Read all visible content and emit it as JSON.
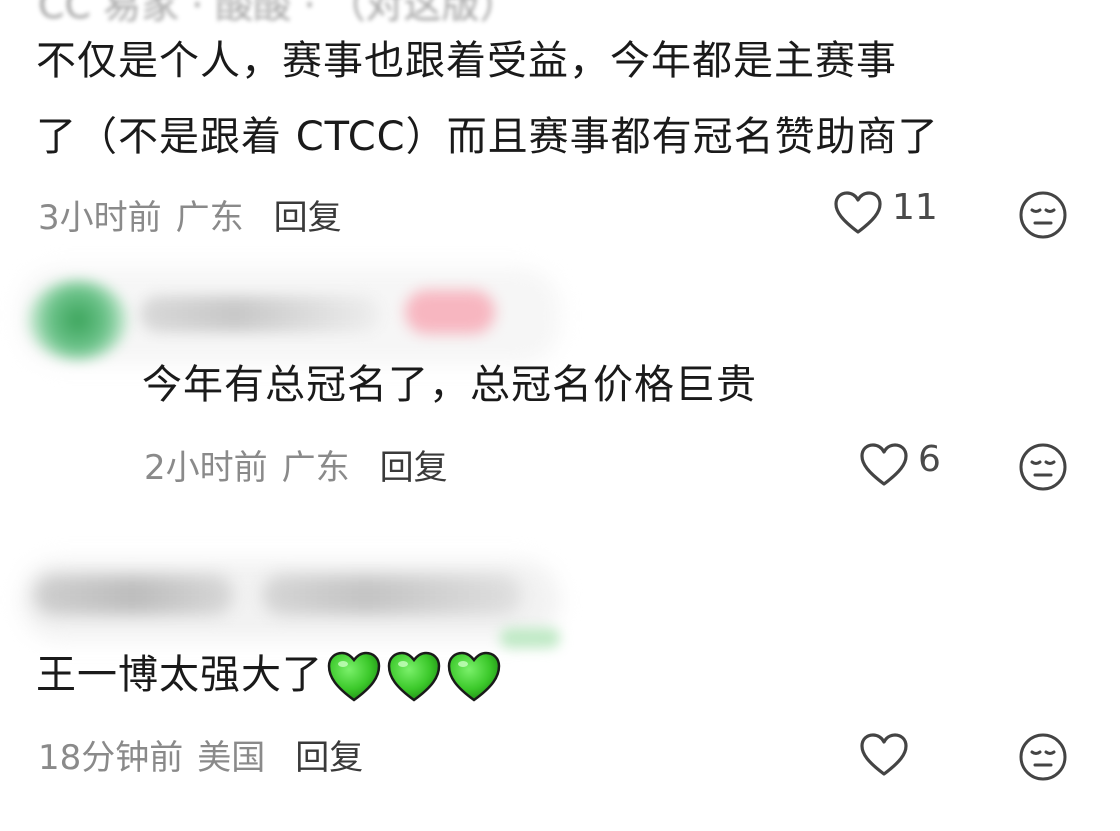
{
  "top_username_cutoff": "CC 易家 · 酸酸 · （对这版）",
  "comment1": {
    "line1": "不仅是个人，赛事也跟着受益，今年都是主赛事",
    "line2": "了（不是跟着 CTCC）而且赛事都有冠名赞助商了",
    "time": "3小时前",
    "location": "广东",
    "reply_label": "回复",
    "like_count": "11"
  },
  "reply1": {
    "text": "今年有总冠名了，总冠名价格巨贵",
    "time": "2小时前",
    "location": "广东",
    "reply_label": "回复",
    "like_count": "6"
  },
  "comment2": {
    "text": "王一博太强大了",
    "emoji": [
      "green-heart",
      "green-heart",
      "green-heart"
    ],
    "time": "18分钟前",
    "location": "美国",
    "reply_label": "回复",
    "like_count": ""
  },
  "colors": {
    "text": "#1a1a1a",
    "meta": "#8a8a8a",
    "reply": "#3a3a3a",
    "icon": "#444444",
    "green_heart": "#3cc92b"
  }
}
